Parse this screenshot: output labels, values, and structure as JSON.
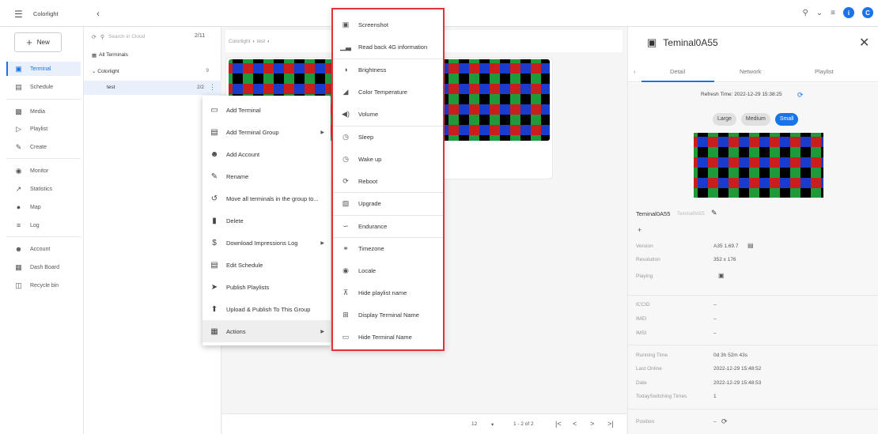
{
  "app": {
    "brand": "Colorlight"
  },
  "sidebar": {
    "new_label": "New",
    "items": [
      {
        "label": "Terminal",
        "icon": "terminal-icon",
        "active": true
      },
      {
        "label": "Schedule",
        "icon": "calendar-icon"
      },
      {
        "label": "Media",
        "icon": "media-icon"
      },
      {
        "label": "Playlist",
        "icon": "playlist-icon"
      },
      {
        "label": "Create",
        "icon": "pencil-icon"
      },
      {
        "label": "Monitor",
        "icon": "eye-icon"
      },
      {
        "label": "Statistics",
        "icon": "trend-icon"
      },
      {
        "label": "Map",
        "icon": "pin-icon"
      },
      {
        "label": "Log",
        "icon": "list-icon"
      },
      {
        "label": "Account",
        "icon": "person-icon"
      },
      {
        "label": "Dash Board",
        "icon": "dashboard-icon"
      },
      {
        "label": "Recycle bin",
        "icon": "trash-icon"
      }
    ]
  },
  "tree": {
    "search_placeholder": "Search in Cloud",
    "count": "2/11",
    "all_terminals": "All Terminals",
    "group_name": "Colorlight",
    "group_count": "9",
    "sub_name": "test",
    "sub_count": "2/2"
  },
  "main": {
    "breadcrumb_root": "Colorlight",
    "breadcrumb_leaf": "test",
    "pager": {
      "per_page": "12",
      "range": "1 - 2 of 2"
    }
  },
  "context_menu": [
    {
      "label": "Add Terminal",
      "icon": "monitor-icon"
    },
    {
      "label": "Add Terminal Group",
      "icon": "group-icon",
      "submenu": true
    },
    {
      "label": "Add Account",
      "icon": "person-icon"
    },
    {
      "label": "Rename",
      "icon": "pencil-icon"
    },
    {
      "label": "Move all terminals in the group to...",
      "icon": "history-icon"
    },
    {
      "label": "Delete",
      "icon": "trash-icon"
    },
    {
      "label": "Download Impressions Log",
      "icon": "dollar-icon",
      "submenu": true
    },
    {
      "label": "Edit Schedule",
      "icon": "calendar-icon"
    },
    {
      "label": "Publish Playlists",
      "icon": "send-icon"
    },
    {
      "label": "Upload & Publish To This Group",
      "icon": "upload-icon"
    },
    {
      "label": "Actions",
      "icon": "grid-icon",
      "submenu": true,
      "highlight": true
    }
  ],
  "actions_menu": [
    {
      "label": "Screenshot",
      "icon": "screenshot-icon"
    },
    {
      "label": "Read back 4G information",
      "icon": "signal-icon"
    },
    {
      "label": "Brightness",
      "icon": "brightness-icon"
    },
    {
      "label": "Color Temperature",
      "icon": "color-temp-icon"
    },
    {
      "label": "Volume",
      "icon": "volume-icon"
    },
    {
      "label": "Sleep",
      "icon": "sleep-icon"
    },
    {
      "label": "Wake up",
      "icon": "alarm-icon"
    },
    {
      "label": "Reboot",
      "icon": "reboot-icon"
    },
    {
      "label": "Upgrade",
      "icon": "upgrade-icon"
    },
    {
      "label": "Endurance",
      "icon": "endurance-icon"
    },
    {
      "label": "Timezone",
      "icon": "globe-icon"
    },
    {
      "label": "Locale",
      "icon": "locale-pin-icon"
    },
    {
      "label": "Hide playlist name",
      "icon": "hide-playlist-icon"
    },
    {
      "label": "Display Terminal Name",
      "icon": "display-name-icon"
    },
    {
      "label": "Hide Terminal Name",
      "icon": "hide-name-icon"
    }
  ],
  "detail": {
    "title": "Teminal0A55",
    "tabs": [
      "Detail",
      "Network",
      "Playlist"
    ],
    "refresh_time": "Refresh Time: 2022-12-29 15:38:25",
    "sizes": [
      "Large",
      "Medium",
      "Small"
    ],
    "name": "Teminal0A55",
    "name_sub": "Teminal0A55",
    "add": "+",
    "rows": [
      {
        "label": "Version",
        "value": "A35 1.69.7"
      },
      {
        "label": "Resolution",
        "value": "352 x 176"
      },
      {
        "label": "Playing",
        "value": ""
      },
      {
        "label": "ICCID",
        "value": "–"
      },
      {
        "label": "IMEI",
        "value": "–"
      },
      {
        "label": "IMSI",
        "value": "–"
      },
      {
        "label": "Running Time",
        "value": "0d 3h 52m 43s"
      },
      {
        "label": "Last Online",
        "value": "2022-12-29 15:48:52"
      },
      {
        "label": "Date",
        "value": "2022-12-29 15:48:53"
      },
      {
        "label": "TodaySwitching Times",
        "value": "1"
      },
      {
        "label": "Position",
        "value": "–"
      }
    ]
  },
  "colors": {
    "accent": "#1a73e8",
    "highlight_border": "#e0343a"
  }
}
